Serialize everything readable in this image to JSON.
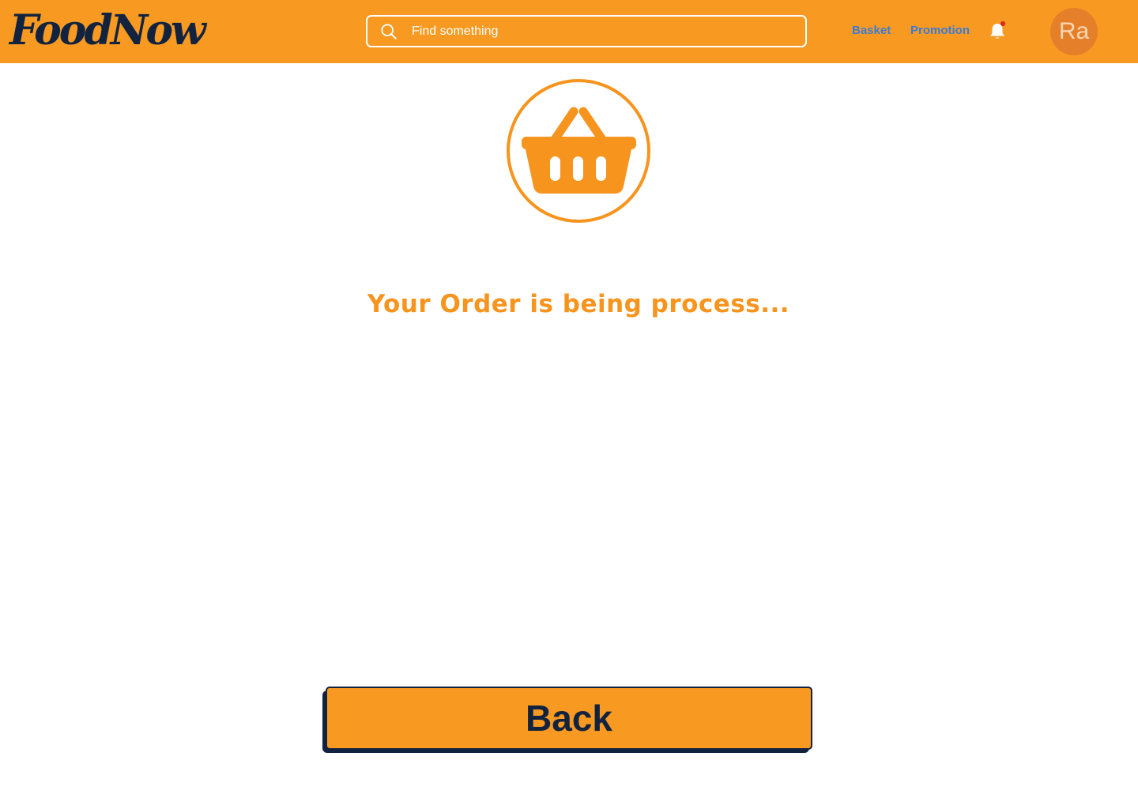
{
  "header": {
    "logo_text": "FoodNow",
    "search": {
      "placeholder": "Find something",
      "value": "",
      "icon": "search-icon"
    },
    "nav": {
      "basket_label": "Basket",
      "promotion_label": "Promotion"
    },
    "notifications": {
      "icon": "bell-icon",
      "has_unread": true
    },
    "avatar_initials": "Ra"
  },
  "main": {
    "graphic": "shopping-basket-icon",
    "status_message": "Your Order is being process...",
    "back_label": "Back"
  },
  "colors": {
    "header_bg": "#f89a22",
    "accent_orange": "#f7941d",
    "navy": "#12233f",
    "nav_link": "#3a7bd5",
    "avatar_bg": "#e57f2a",
    "notification_dot": "#e0231c"
  }
}
